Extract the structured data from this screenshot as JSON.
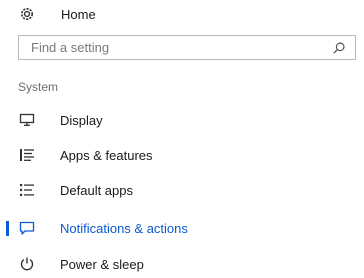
{
  "home": {
    "label": "Home",
    "icon": "gear-icon"
  },
  "search": {
    "placeholder": "Find a setting",
    "value": "",
    "icon": "search-icon"
  },
  "section": {
    "title": "System"
  },
  "nav_items": [
    {
      "label": "Display",
      "icon": "monitor-icon",
      "selected": false
    },
    {
      "label": "Apps & features",
      "icon": "apps-list-icon",
      "selected": false
    },
    {
      "label": "Default apps",
      "icon": "default-apps-icon",
      "selected": false
    },
    {
      "label": "Notifications & actions",
      "icon": "notification-icon",
      "selected": true
    },
    {
      "label": "Power & sleep",
      "icon": "power-icon",
      "selected": false
    }
  ],
  "colors": {
    "accent": "#0a5bd3",
    "text": "#1a1a1a",
    "muted": "#6f6f6f",
    "border": "#b9b9b9"
  }
}
